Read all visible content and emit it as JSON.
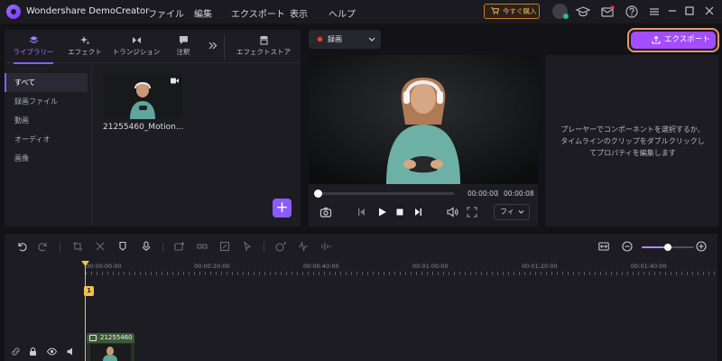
{
  "app": {
    "title": "Wondershare DemoCreator"
  },
  "menu": [
    "ファイル",
    "編集",
    "エクスポート",
    "表示",
    "ヘルプ"
  ],
  "titlebar": {
    "buy_label": "今すぐ購入"
  },
  "tabs": [
    {
      "label": "ライブラリー",
      "icon": "layers-icon",
      "active": true
    },
    {
      "label": "エフェクト",
      "icon": "sparkle-icon"
    },
    {
      "label": "トランジション",
      "icon": "transition-icon"
    },
    {
      "label": "注釈",
      "icon": "annotation-icon"
    },
    {
      "label": "エフェクトストア",
      "icon": "store-icon"
    }
  ],
  "library": {
    "nav": [
      "すべて",
      "録画ファイル",
      "動画",
      "オーディオ",
      "画像"
    ],
    "media": [
      {
        "name": "21255460_Motion..."
      }
    ]
  },
  "preview": {
    "record_label": "録画",
    "time_current": "00:00:00",
    "time_separator": "|",
    "time_total": "00:00:08",
    "fit_label": "フィ"
  },
  "properties": {
    "hint": "プレーヤーでコンポーネントを選択するか、タイムラインのクリップをダブルクリックしてプロパティを編集します"
  },
  "export": {
    "label": "エクスポート"
  },
  "timeline": {
    "ruler_labels": [
      "00:00:00:00",
      "00:00:20:00",
      "00:00:40:00",
      "00:01:00:00",
      "00:01:20:00",
      "00:01:40:00"
    ],
    "marker_label": "1",
    "clip_label": "21255460",
    "zoom_level": 0.5
  },
  "colors": {
    "accent": "#8a5cff",
    "export": "#a34dff",
    "record": "#e14545",
    "playhead": "#f0c24a",
    "clip": "#3c5a38"
  }
}
